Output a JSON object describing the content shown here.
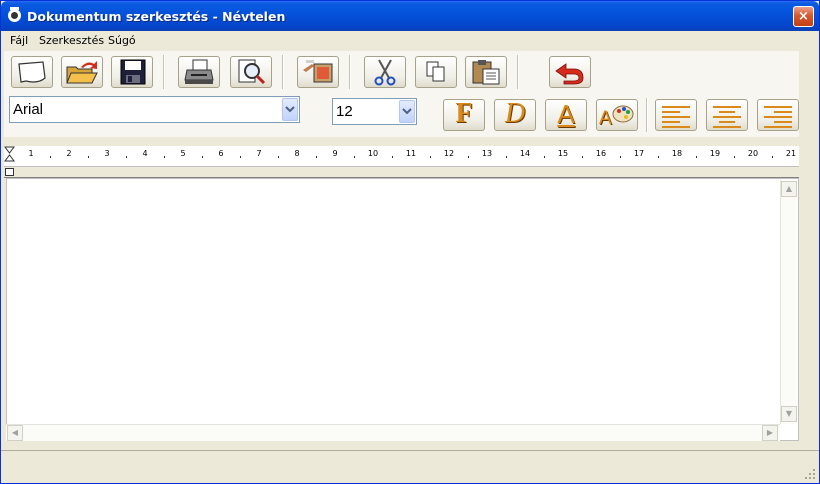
{
  "window": {
    "title": "Dokumentum szerkesztés - Névtelen",
    "close_glyph": "×"
  },
  "menu": [
    "Fájl",
    "Szerkesztés",
    "Súgó"
  ],
  "toolbar1": [
    {
      "name": "new-doc",
      "icon": "new-document-icon"
    },
    {
      "name": "open",
      "icon": "open-folder-icon"
    },
    {
      "name": "save",
      "icon": "floppy-disk-icon"
    },
    {
      "name": "print",
      "icon": "printer-icon"
    },
    {
      "name": "print-preview",
      "icon": "print-preview-icon"
    },
    {
      "name": "insert-image",
      "icon": "insert-image-icon"
    },
    {
      "name": "cut",
      "icon": "scissors-icon"
    },
    {
      "name": "copy",
      "icon": "copy-icon"
    },
    {
      "name": "paste",
      "icon": "paste-icon"
    },
    {
      "name": "undo",
      "icon": "undo-arrow-icon"
    }
  ],
  "font": {
    "name": "Arial",
    "size": "12"
  },
  "format_buttons": {
    "bold": "F",
    "italic": "D",
    "underline": "A",
    "color": "A"
  },
  "ruler": {
    "numbers": [
      "1",
      "2",
      "3",
      "4",
      "5",
      "6",
      "7",
      "8",
      "9",
      "10",
      "11",
      "12",
      "13",
      "14",
      "15",
      "16",
      "17",
      "18",
      "19",
      "20",
      "21"
    ]
  },
  "scroll": {
    "up": "▲",
    "down": "▼",
    "left": "◀",
    "right": "▶"
  },
  "colors": {
    "accent": "#d98a1a",
    "title_bar": "#0553dc",
    "undo": "#d62a1a"
  }
}
